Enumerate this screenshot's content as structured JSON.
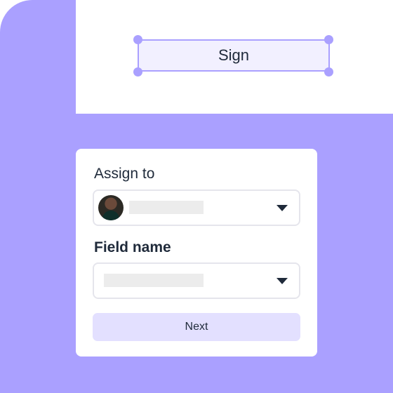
{
  "document": {
    "sign_field_label": "Sign"
  },
  "assign_form": {
    "assign_to_label": "Assign to",
    "assignee_select": {
      "avatar": "user-avatar",
      "selected_value": ""
    },
    "field_name_label": "Field name",
    "field_name_select": {
      "selected_value": ""
    },
    "next_label": "Next"
  },
  "colors": {
    "accent": "#aaa0ff",
    "field_fill": "#f2f0ff",
    "button_fill": "#e3e0ff",
    "text": "#1f2a3a",
    "placeholder": "#ececec"
  },
  "icons": {
    "dropdown": "caret-down-icon",
    "resize_handle": "circle-handle"
  }
}
